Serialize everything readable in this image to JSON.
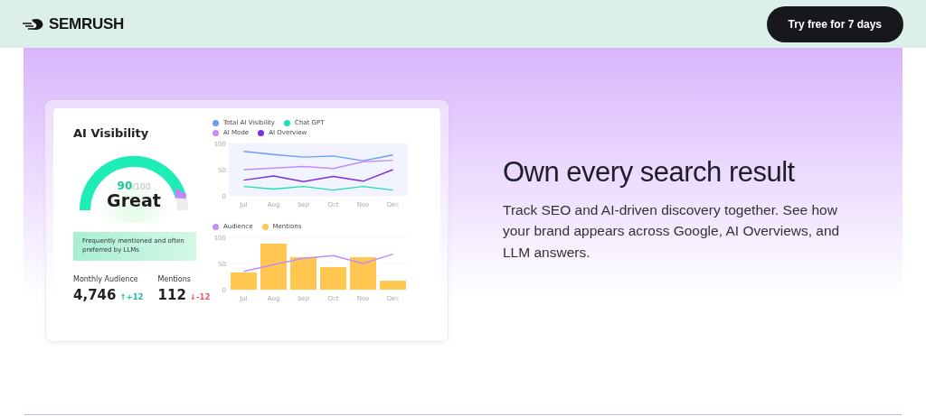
{
  "header": {
    "logo": "SEMRUSH",
    "cta": "Try free for 7 days"
  },
  "card": {
    "title": "AI Visibility",
    "gauge": {
      "score": "90",
      "max": "/100",
      "rating": "Great"
    },
    "note": "Frequently mentioned and often preferred by LLMs",
    "stats": [
      {
        "label": "Monthly Audience",
        "value": "4,746",
        "change": "↑+12",
        "color": "#1ac599"
      },
      {
        "label": "Mentions",
        "value": "112",
        "change": "↓-12",
        "color": "#f05a5a"
      }
    ],
    "line_chart": {
      "chart_data": {
        "type": "line",
        "categories": [
          "Jul",
          "Aug",
          "Sep",
          "Oct",
          "Nov",
          "Dec"
        ],
        "ylim": [
          0,
          100
        ],
        "yticks": [
          0,
          50,
          100
        ],
        "series": [
          {
            "name": "Total AI Visibility",
            "color": "#6b9cf7",
            "values": [
              85,
              79,
              74,
              76,
              67,
              78
            ]
          },
          {
            "name": "Chat GPT",
            "color": "#1de0b4",
            "values": [
              18,
              13,
              18,
              11,
              18,
              11
            ]
          },
          {
            "name": "AI Mode",
            "color": "#c08ef5",
            "values": [
              50,
              53,
              56,
              52,
              65,
              68
            ]
          },
          {
            "name": "AI Overview",
            "color": "#7c2fe0",
            "values": [
              30,
              38,
              27,
              37,
              28,
              50
            ]
          }
        ]
      }
    },
    "bar_chart": {
      "chart_data": {
        "type": "bar",
        "categories": [
          "Jul",
          "Aug",
          "Sep",
          "Oct",
          "Nov",
          "Dec"
        ],
        "ylim": [
          0,
          100
        ],
        "yticks": [
          0,
          50,
          100
        ],
        "series": [
          {
            "name": "Audience",
            "type": "line",
            "color": "#c08ef5",
            "values": [
              35,
              48,
              60,
              65,
              50,
              68
            ]
          },
          {
            "name": "Mentions",
            "type": "bar",
            "color": "#ffc74f",
            "values": [
              33,
              88,
              62,
              43,
              62,
              17
            ]
          }
        ]
      }
    }
  },
  "hero": {
    "heading": "Own every search result",
    "body": "Track SEO and AI-driven discovery together. See how your brand appears across Google, AI Overviews, and LLM answers."
  }
}
